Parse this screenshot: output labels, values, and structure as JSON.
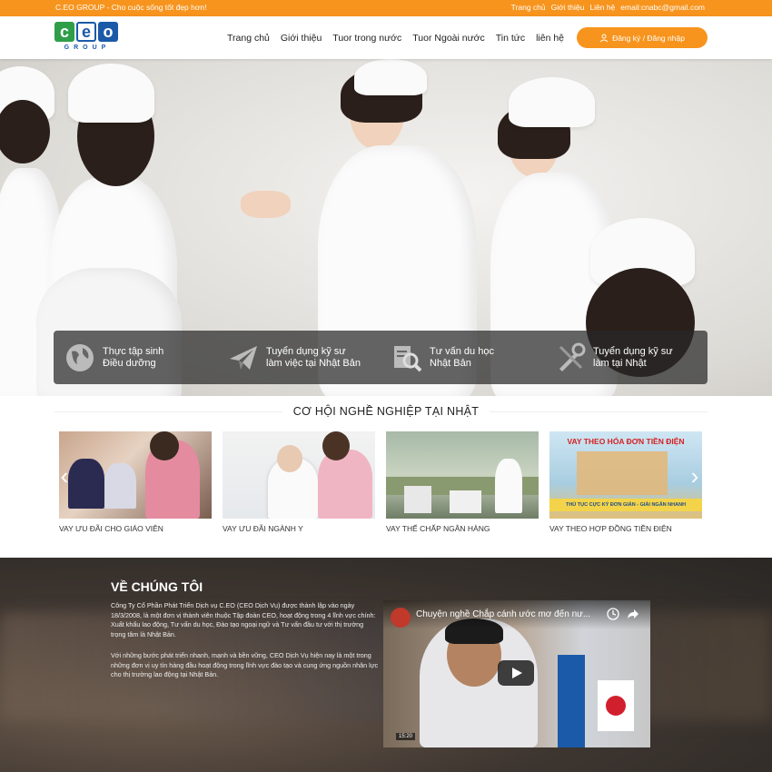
{
  "topbar": {
    "slogan": "C.EO GROUP - Cho cuộc sống tốt đẹp hơn!",
    "links": [
      "Trang chủ",
      "Giới thiệu",
      "Liên hệ",
      "email:cnabc@gmail.com"
    ]
  },
  "header": {
    "logo_text": "CEO",
    "logo_sub": "GROUP",
    "nav": [
      "Trang chủ",
      "Giới thiệu",
      "Tuor trong nước",
      "Tuor Ngoài nước",
      "Tin tức",
      "liên hệ"
    ],
    "register_label": "Đăng ký / Đăng nhập"
  },
  "hero": {
    "features": [
      {
        "line1": "Thực tập sinh",
        "line2": "Điều dưỡng",
        "icon": "globe-icon"
      },
      {
        "line1": "Tuyển dụng kỹ sư",
        "line2": "làm việc tại Nhật Bản",
        "icon": "paper-plane-icon"
      },
      {
        "line1": "Tư vấn du học",
        "line2": "Nhật Bản",
        "icon": "search-document-icon"
      },
      {
        "line1": "Tuyển dụng kỹ sư",
        "line2": "làm tại Nhật",
        "icon": "tools-icon"
      }
    ]
  },
  "career": {
    "title": "CƠ HỘI NGHỀ NGHIỆP TẠI NHẬT",
    "cards": [
      {
        "caption": "VAY ƯU ĐÃI CHO GIÁO VIÊN"
      },
      {
        "caption": "VAY ƯU ĐÃI NGÀNH Y"
      },
      {
        "caption": "VAY THẾ CHẤP NGÂN HÀNG"
      },
      {
        "caption": "VAY THEO HỢP ĐỒNG TIỀN ĐIỆN",
        "banner_top": "VAY THEO HÓA ĐƠN TIỀN ĐIỆN",
        "banner_bottom": "THỦ TỤC CỰC KỲ ĐƠN GIẢN - GIẢI NGÂN NHANH"
      }
    ]
  },
  "about": {
    "title": "VỀ CHÚNG TÔI",
    "p1": "Công Ty Cổ Phần Phát Triển Dịch vụ C.EO (CEO Dịch Vụ) được thành lập vào ngày 18/3/2008, là một đơn vị thành viên thuộc Tập đoàn CEO, hoạt động trong 4 lĩnh vực chính: Xuất khẩu lao động, Tư vấn du học, Đào tạo ngoại ngữ và Tư vấn đầu tư với thị trường trọng tâm là Nhật Bản.",
    "p2": "Với những bước phát triển nhanh, mạnh và bền vững, CEO Dịch Vụ hiện nay là một trong những đơn vị uy tín hàng đầu hoạt động trong lĩnh vực đào tạo và cung ứng nguồn nhân lực cho thị trường lao động tại Nhật Bản.",
    "video_title": "Chuyện nghề Chắp cánh ước mơ đến nư...",
    "video_time": "15:20"
  },
  "colors": {
    "accent": "#f7941d",
    "logo_green": "#2e9e48",
    "logo_blue": "#1b5aa8"
  }
}
